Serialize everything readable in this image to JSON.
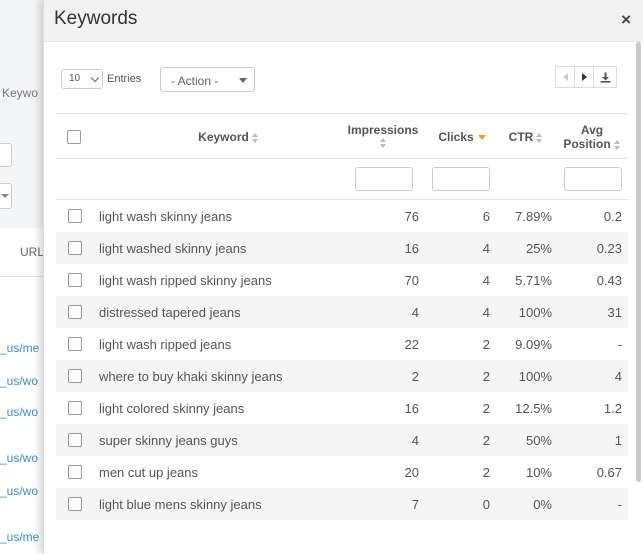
{
  "background": {
    "label_partial": "Keywo",
    "column_partial": "URL",
    "links": [
      "_us/me",
      "_us/wo",
      "_us/wo",
      "_us/wo",
      "_us/wo",
      "_us/me"
    ]
  },
  "modal": {
    "title": "Keywords",
    "close": "×"
  },
  "toolbar": {
    "entries_value": "10",
    "entries_label": "Entries",
    "action_value": "- Action -"
  },
  "table": {
    "columns": {
      "keyword": "Keyword",
      "impressions": "Impressions",
      "clicks": "Clicks",
      "ctr": "CTR",
      "avg_position_1": "Avg",
      "avg_position_2": "Position"
    },
    "sorted_by": "Clicks",
    "rows": [
      {
        "keyword": "light wash skinny jeans",
        "impressions": "76",
        "clicks": "6",
        "ctr": "7.89%",
        "avg_position": "0.2"
      },
      {
        "keyword": "light washed skinny jeans",
        "impressions": "16",
        "clicks": "4",
        "ctr": "25%",
        "avg_position": "0.23"
      },
      {
        "keyword": "light wash ripped skinny jeans",
        "impressions": "70",
        "clicks": "4",
        "ctr": "5.71%",
        "avg_position": "0.43"
      },
      {
        "keyword": "distressed tapered jeans",
        "impressions": "4",
        "clicks": "4",
        "ctr": "100%",
        "avg_position": "31"
      },
      {
        "keyword": "light wash ripped jeans",
        "impressions": "22",
        "clicks": "2",
        "ctr": "9.09%",
        "avg_position": "-"
      },
      {
        "keyword": "where to buy khaki skinny jeans",
        "impressions": "2",
        "clicks": "2",
        "ctr": "100%",
        "avg_position": "4"
      },
      {
        "keyword": "light colored skinny jeans",
        "impressions": "16",
        "clicks": "2",
        "ctr": "12.5%",
        "avg_position": "1.2"
      },
      {
        "keyword": "super skinny jeans guys",
        "impressions": "4",
        "clicks": "2",
        "ctr": "50%",
        "avg_position": "1"
      },
      {
        "keyword": "men cut up jeans",
        "impressions": "20",
        "clicks": "2",
        "ctr": "10%",
        "avg_position": "0.67"
      },
      {
        "keyword": "light blue mens skinny jeans",
        "impressions": "7",
        "clicks": "0",
        "ctr": "0%",
        "avg_position": "-"
      }
    ]
  },
  "colors": {
    "sort_active": "#f0a020",
    "link": "#3a8fd0",
    "header_bg": "#f2f2f2",
    "row_alt_bg": "#f5f5f5"
  }
}
